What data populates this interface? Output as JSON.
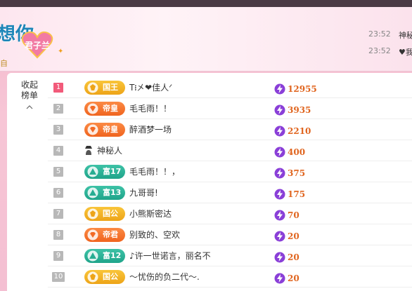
{
  "banner": {
    "title_fragment": "想你",
    "heart_label": "君子兰",
    "sub_fragment": "自"
  },
  "chat": [
    {
      "time": "23:52",
      "text": "神秘"
    },
    {
      "time": "23:52",
      "text": "♥我"
    }
  ],
  "sidebar": {
    "collapse_label_1": "收起",
    "collapse_label_2": "榜单"
  },
  "colors": {
    "rank_top": "#f25a7a",
    "rank_default": "#b8b8b8",
    "badge_gold": "#f2b02a",
    "badge_orange": "#f6763a",
    "badge_teal": "#2cb398",
    "score_text": "#e0651f",
    "bolt": "#8a3fd8"
  },
  "leaderboard": [
    {
      "rank": "1",
      "badge": "国王",
      "badge_type": "gold",
      "name": "T᎒㐅❤佳人ᐟ",
      "score": "12955"
    },
    {
      "rank": "2",
      "badge": "帝皇",
      "badge_type": "orange",
      "name": "毛毛雨！！",
      "score": "3935"
    },
    {
      "rank": "3",
      "badge": "帝皇",
      "badge_type": "orange",
      "name": "醉酒梦一场",
      "score": "2210"
    },
    {
      "rank": "4",
      "badge": "",
      "badge_type": "none",
      "name": "神秘人",
      "score": "400"
    },
    {
      "rank": "5",
      "badge": "富17",
      "badge_type": "teal",
      "name": "毛毛雨！！，",
      "score": "375"
    },
    {
      "rank": "6",
      "badge": "富13",
      "badge_type": "teal",
      "name": "九哥哥!",
      "score": "175"
    },
    {
      "rank": "7",
      "badge": "国公",
      "badge_type": "gold",
      "name": "小熊斯密达",
      "score": "70"
    },
    {
      "rank": "8",
      "badge": "帝君",
      "badge_type": "orange",
      "name": "别致的、空欢",
      "score": "20"
    },
    {
      "rank": "9",
      "badge": "富12",
      "badge_type": "teal",
      "name": "♪许一世诺言，丽名不",
      "score": "20"
    },
    {
      "rank": "10",
      "badge": "国公",
      "badge_type": "gold",
      "name": "～忧伤的负二代～.",
      "score": "20"
    }
  ]
}
